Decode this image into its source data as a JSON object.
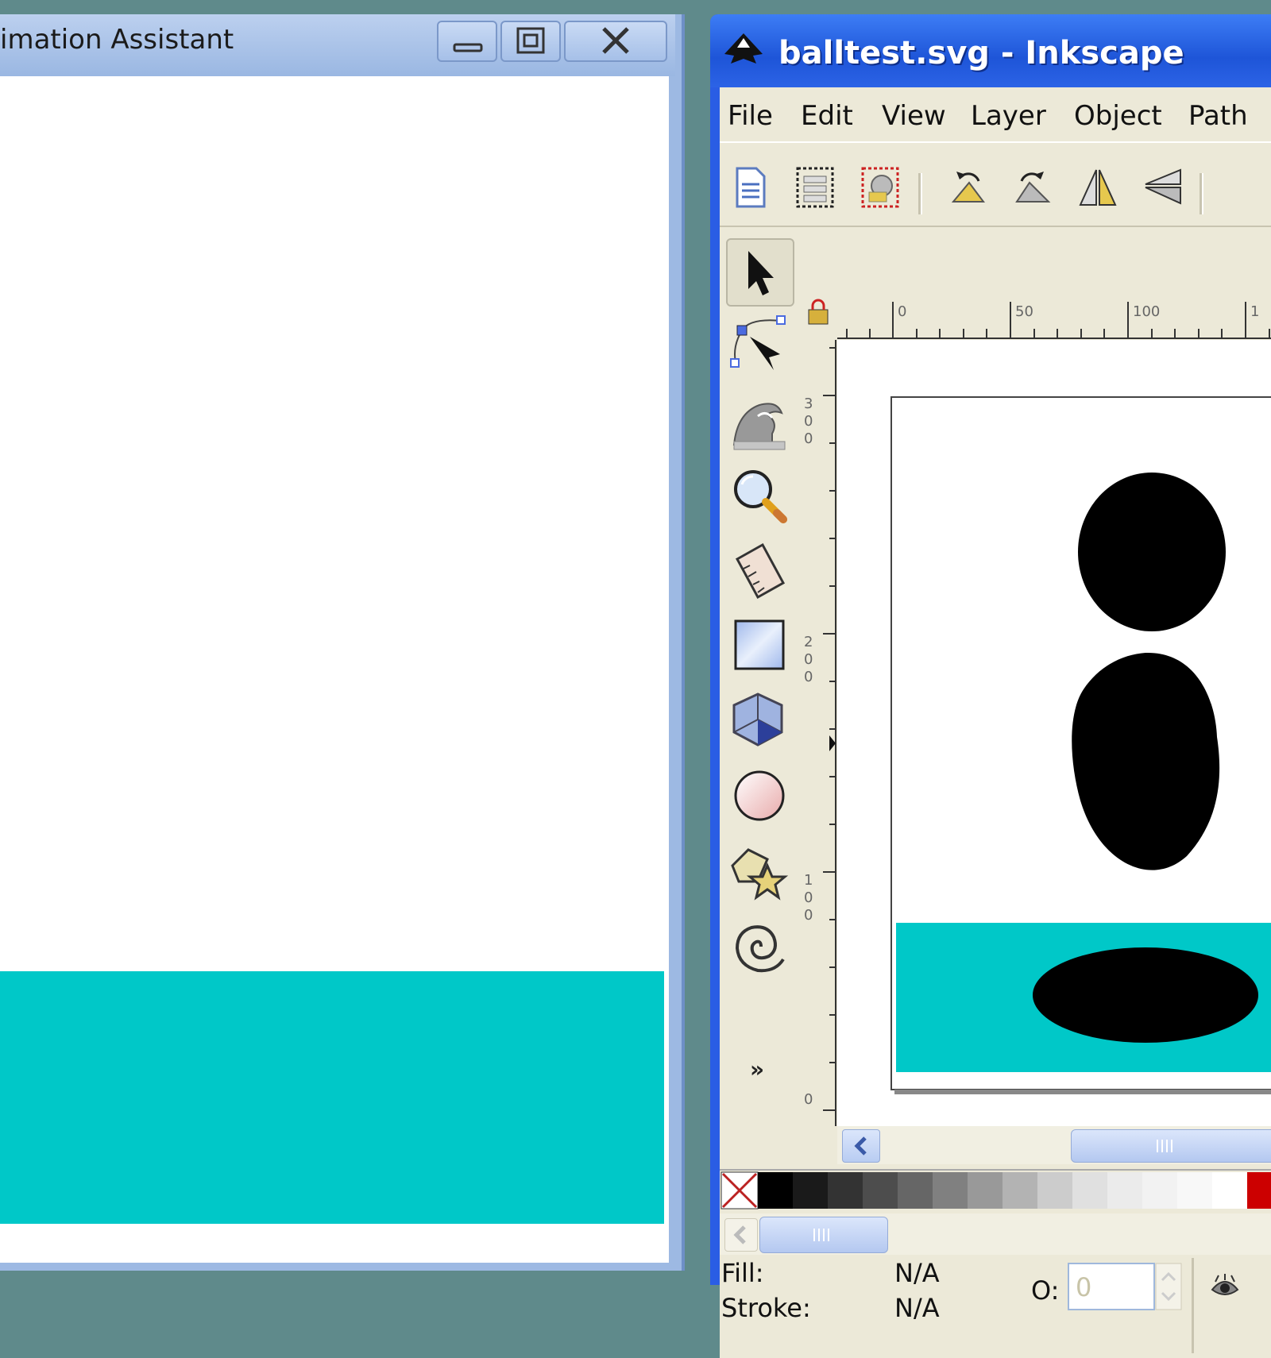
{
  "left_window": {
    "title": "imation Assistant",
    "colors": {
      "ground": "#00c8c8",
      "canvas": "#ffffff"
    }
  },
  "right_window": {
    "title": "balltest.svg - Inkscape",
    "menu": [
      "File",
      "Edit",
      "View",
      "Layer",
      "Object",
      "Path"
    ],
    "toolbar_icons": [
      "new-document-icon",
      "select-all-icon",
      "select-all-in-all-layers-icon",
      "rotate-ccw-icon",
      "rotate-cw-icon",
      "flip-horizontal-icon",
      "flip-vertical-icon"
    ],
    "tools": [
      "selector-tool-icon",
      "node-tool-icon",
      "tweak-tool-icon",
      "zoom-tool-icon",
      "measure-tool-icon",
      "rectangle-tool-icon",
      "3d-box-tool-icon",
      "ellipse-tool-icon",
      "star-tool-icon",
      "spiral-tool-icon"
    ],
    "more_tools": "»",
    "ruler_top_labels": [
      "0",
      "50",
      "100",
      "1"
    ],
    "ruler_left_labels": [
      "300",
      "200",
      "100",
      "0"
    ],
    "status": {
      "fill_label": "Fill:",
      "fill_value": "N/A",
      "stroke_label": "Stroke:",
      "stroke_value": "N/A",
      "opacity_label": "O:",
      "opacity_value": "0"
    },
    "colors": {
      "ground": "#00c8c8",
      "ball": "#000000",
      "title_bar": "#2a5de4"
    }
  }
}
